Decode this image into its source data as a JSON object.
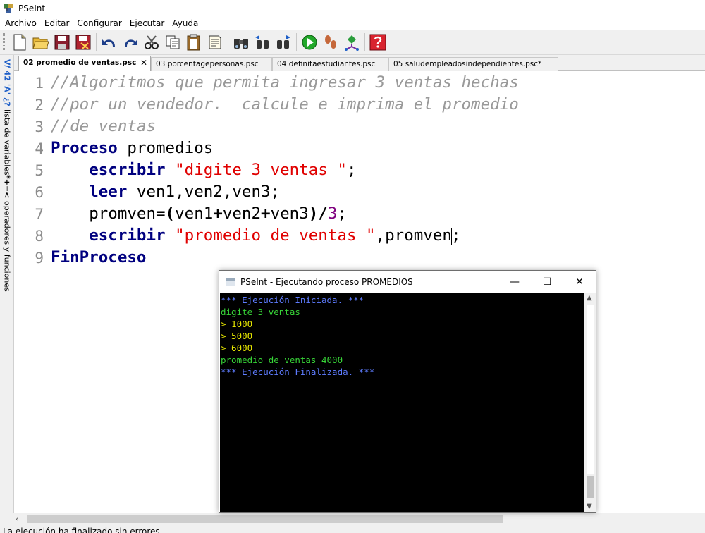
{
  "window": {
    "title": "PSeInt"
  },
  "menu": [
    {
      "label": "Archivo"
    },
    {
      "label": "Editar"
    },
    {
      "label": "Configurar"
    },
    {
      "label": "Ejecutar"
    },
    {
      "label": "Ayuda"
    }
  ],
  "left_panel": {
    "variables_symbols": "V𝑓 42 'A' ¿?",
    "variables_label": "lista de variables",
    "operators_symbols": "*+=<",
    "operators_label": "operadores y funciones"
  },
  "tabs": [
    {
      "label": "02 promedio de ventas.psc",
      "active": true,
      "close": "✕"
    },
    {
      "label": "03 porcentagepersonas.psc",
      "active": false
    },
    {
      "label": "04 definitaestudiantes.psc",
      "active": false
    },
    {
      "label": "05 saludempleadosindependientes.psc*",
      "active": false
    }
  ],
  "line_numbers": [
    "1",
    "2",
    "3",
    "4",
    "5",
    "6",
    "7",
    "8",
    "9"
  ],
  "code": {
    "l1": "//Algoritmos que permita ingresar 3 ventas hechas",
    "l2": "//por un vendedor.  calcule e imprima el promedio",
    "l3": "//de ventas",
    "l4_kw": "Proceso",
    "l4_id": " promedios",
    "l5_kw": "escribir",
    "l5_str": "\"digite 3 ventas \"",
    "l5_end": ";",
    "l6_kw": "leer",
    "l6_rest": " ven1,ven2,ven3;",
    "l7_a": "promven",
    "l7_op1": "=(",
    "l7_b": "ven1",
    "l7_op2": "+",
    "l7_c": "ven2",
    "l7_op3": "+",
    "l7_d": "ven3",
    "l7_op4": ")/",
    "l7_num": "3",
    "l7_end": ";",
    "l8_kw": "escribir",
    "l8_str": "\"promedio de ventas \"",
    "l8_mid": ",promven",
    "l8_end": ";",
    "l9_kw": "FinProceso"
  },
  "console": {
    "title": "PSeInt - Ejecutando proceso PROMEDIOS",
    "minimize": "—",
    "maximize": "☐",
    "close": "✕",
    "lines": [
      {
        "text": "*** Ejecución Iniciada. ***",
        "color": "#5e7cff"
      },
      {
        "text": "digite 3 ventas",
        "color": "#37d437"
      },
      {
        "text": "> 1000",
        "color": "#e6e600"
      },
      {
        "text": "> 5000",
        "color": "#e6e600"
      },
      {
        "text": "> 6000",
        "color": "#e6e600"
      },
      {
        "text": "promedio de ventas 4000",
        "color": "#37d437"
      },
      {
        "text": "*** Ejecución Finalizada. ***",
        "color": "#5e7cff"
      }
    ]
  },
  "status": {
    "text": "La ejecución ha finalizado sin errores."
  },
  "colors": {
    "keyword": "#00007f",
    "string": "#e00000",
    "comment": "#999999",
    "number": "#7f007f"
  }
}
